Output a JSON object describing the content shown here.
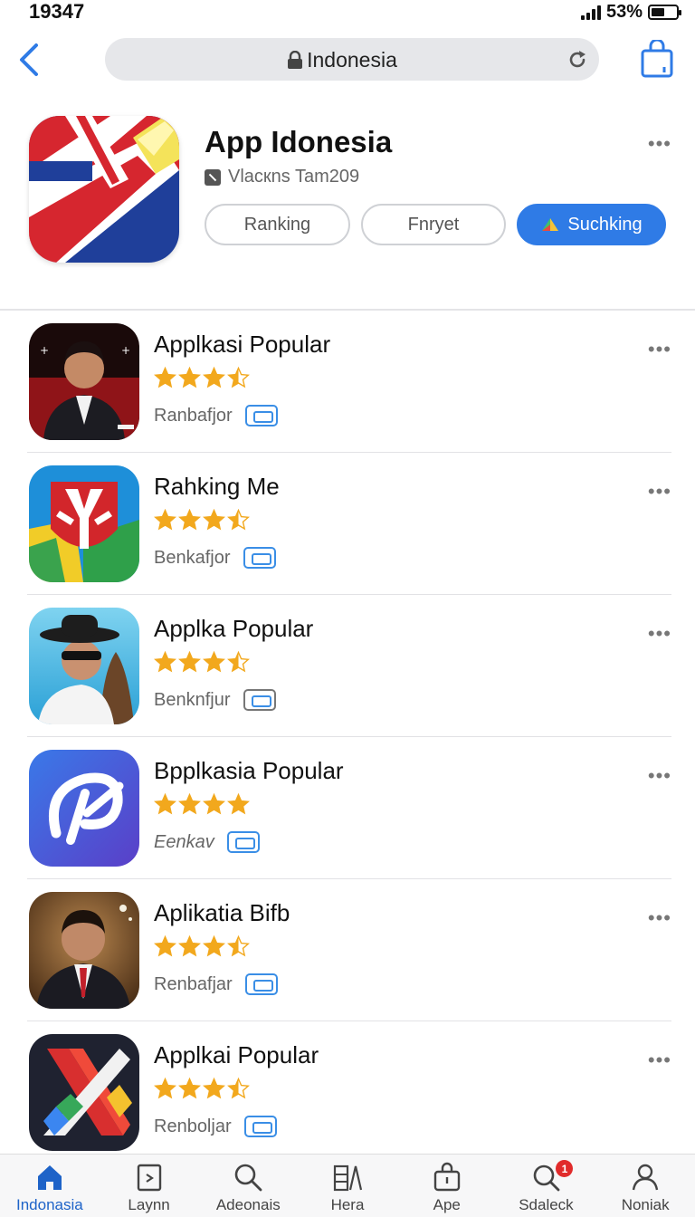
{
  "status_bar": {
    "time": "19347",
    "battery": "53%",
    "battery_level": 0.53
  },
  "browser": {
    "url": "Indonesia"
  },
  "hero": {
    "title": "App Idonesia",
    "developer": "Vlacкns Tam209",
    "buttons": [
      {
        "label": "Ranking"
      },
      {
        "label": "Fnryet"
      },
      {
        "label": "Suchking"
      }
    ],
    "accent": "#2f7be6"
  },
  "apps": [
    {
      "name": "Applkasi Popular",
      "rating": 3.5,
      "category": "Ranbafjor",
      "icon": "man-portrait-red-icon"
    },
    {
      "name": "Rahking Me",
      "rating": 3.5,
      "category": "Benkafjor",
      "icon": "y-shield-icon"
    },
    {
      "name": "Applka Popular",
      "rating": 3.5,
      "category": "Benknfjur",
      "icon": "cowboy-portrait-icon"
    },
    {
      "name": "Bpplkasia Popular",
      "rating": 4.0,
      "category": "Eenkav",
      "icon": "swirl-logo-icon"
    },
    {
      "name": "Aplikatia Bifb",
      "rating": 3.5,
      "category": "Renbafjar",
      "icon": "businessman-portrait-icon"
    },
    {
      "name": "Applkai Popular",
      "rating": 3.5,
      "category": "Renboljar",
      "icon": "x-stripes-icon"
    }
  ],
  "tabs": [
    {
      "label": "Indonasia",
      "icon": "home-icon",
      "active": true
    },
    {
      "label": "Laynn",
      "icon": "calendar-icon"
    },
    {
      "label": "Adeonais",
      "icon": "search-icon"
    },
    {
      "label": "Hera",
      "icon": "editor-icon"
    },
    {
      "label": "Ape",
      "icon": "bag-icon"
    },
    {
      "label": "Sdaleck",
      "icon": "notifications-search-icon",
      "badge": "1"
    },
    {
      "label": "Noniak",
      "icon": "profile-icon"
    }
  ],
  "colors": {
    "star": "#f2a81d",
    "star_empty": "#f2a81d",
    "tab_active": "#1e63c8"
  }
}
